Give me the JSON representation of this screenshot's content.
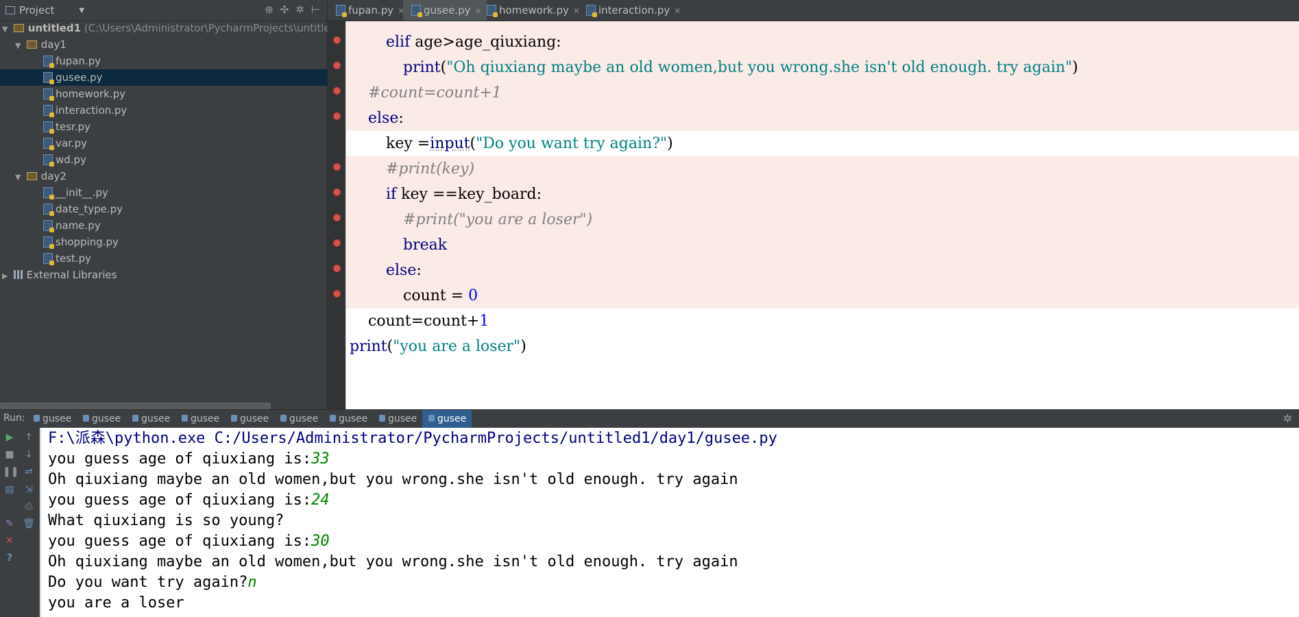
{
  "project_panel": {
    "title": "Project",
    "root": {
      "name": "untitled1",
      "path": "(C:\\Users\\Administrator\\PycharmProjects\\untitled"
    },
    "folders": [
      {
        "name": "day1",
        "files": [
          "fupan.py",
          "gusee.py",
          "homework.py",
          "interaction.py",
          "tesr.py",
          "var.py",
          "wd.py"
        ]
      },
      {
        "name": "day2",
        "files": [
          "__init__.py",
          "date_type.py",
          "name.py",
          "shopping.py",
          "test.py"
        ]
      }
    ],
    "external_libraries": "External Libraries",
    "selected_file": "gusee.py"
  },
  "editor": {
    "tabs": [
      {
        "label": "fupan.py",
        "active": false
      },
      {
        "label": "gusee.py",
        "active": true
      },
      {
        "label": "homework.py",
        "active": false
      },
      {
        "label": "interaction.py",
        "active": false
      }
    ],
    "lines": {
      "l1_kw": "elif",
      "l1_a": " age>age_qiuxiang:",
      "l2_fn": "print",
      "l2_a": "(",
      "l2_str": "\"Oh qiuxiang maybe an old women,but you wrong.she isn't old enough. try again\"",
      "l2_b": ")",
      "l3_cmt": "#count=count+1",
      "l4_kw": "else",
      "l4_a": ":",
      "l5_a": "key =",
      "l5_fn": "input",
      "l5_b": "(",
      "l5_str": "\"Do you want try again?\"",
      "l5_c": ")",
      "l6_cmt": "#print(key)",
      "l7_kw": "if",
      "l7_a": " key ==key_board:",
      "l8_cmt": "#print(\"you are a loser\")",
      "l9_kw": "break",
      "l10_kw": "else",
      "l10_a": ":",
      "l11_a": "count = ",
      "l11_num": "0",
      "l12_a": "count=count+",
      "l12_num": "1",
      "l13_fn": "print",
      "l13_a": "(",
      "l13_str": "\"you are a loser\"",
      "l13_b": ")"
    }
  },
  "run": {
    "label": "Run:",
    "tabs": [
      "gusee",
      "gusee",
      "gusee",
      "gusee",
      "gusee",
      "gusee",
      "gusee",
      "gusee",
      "gusee"
    ],
    "console": {
      "command": "F:\\派森\\python.exe C:/Users/Administrator/PycharmProjects/untitled1/day1/gusee.py",
      "prompt": "you guess age of qiuxiang is:",
      "inputs": [
        "33",
        "24",
        "30"
      ],
      "msg_old": "Oh qiuxiang maybe an old women,but you wrong.she isn't old enough. try again",
      "msg_young": "What qiuxiang is so young?",
      "again_prompt": "Do you want try again?",
      "again_input": "n",
      "loser": "you are a loser"
    }
  },
  "colors": {
    "breakpoint": "#d5534c",
    "highlight_line": "#faebe7",
    "selection": "#0d293e",
    "active_run_tab": "#2e5f8f"
  }
}
